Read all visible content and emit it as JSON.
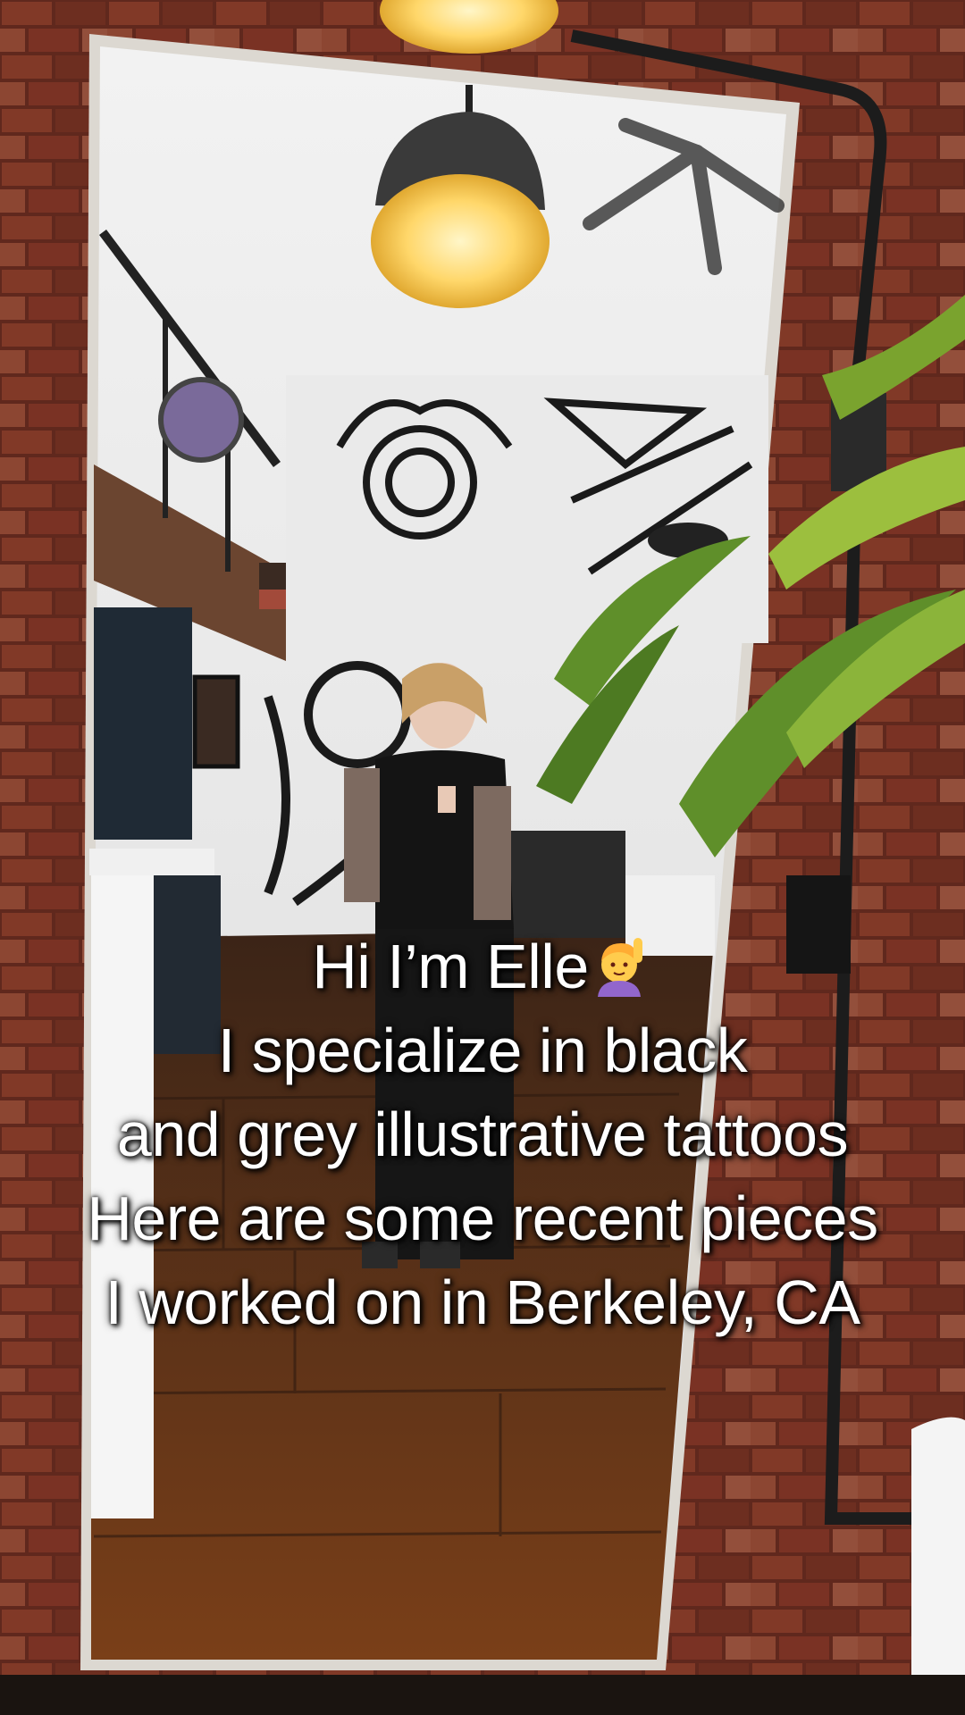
{
  "caption": {
    "line1": "Hi I’m Elle",
    "line1_emoji": "raising-hand-emoji",
    "line2": "I specialize in black",
    "line3": "and grey illustrative tattoos",
    "line4": "Here are some recent pieces",
    "line5": "I worked on in Berkeley, CA"
  },
  "colors": {
    "brick": "#8a3a2a",
    "wood_floor": "#6b3a1a",
    "mirror_frame": "#d9d6d0",
    "lamp_glow": "#ffd76a",
    "plant": "#5f8f2a"
  }
}
